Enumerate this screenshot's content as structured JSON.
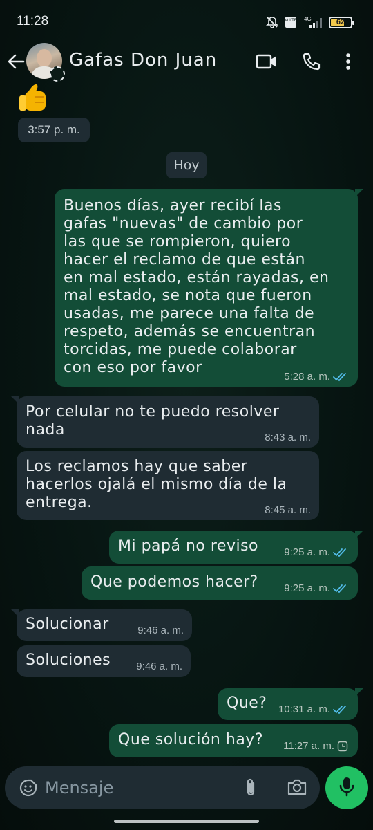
{
  "status_bar": {
    "time": "11:28",
    "battery": "62",
    "network": "4G",
    "volte": "VoLTE",
    "icons": [
      "mute-bell-icon",
      "volte-icon",
      "signal-icon",
      "battery-icon"
    ]
  },
  "header": {
    "contact_name": "Gafas Don Juan",
    "icons": [
      "back-arrow-icon",
      "avatar",
      "status-ring-icon",
      "video-call-icon",
      "phone-icon",
      "more-vert-icon"
    ]
  },
  "chat": {
    "prev_time": "3:57 p. m.",
    "date_chip": "Hoy",
    "messages": [
      {
        "direction": "out",
        "text": "Buenos días, ayer recibí las\ngafas \"nuevas\" de cambio por\nlas que se rompieron, quiero\nhacer el reclamo de que están\nen mal estado, están rayadas, en\nmal estado, se nota que fueron\nusadas, me parece una falta de\nrespeto, además se encuentran\ntorcidas, me puede colaborar\ncon eso por favor",
        "time": "5:28 a. m.",
        "status": "read"
      },
      {
        "direction": "in",
        "text": "Por celular no te puedo resolver\nnada",
        "time": "8:43 a. m."
      },
      {
        "direction": "in",
        "text": "Los reclamos hay que saber\nhacerlos ojalá el mismo día de la\nentrega.",
        "time": "8:45 a. m."
      },
      {
        "direction": "out",
        "text": "Mi papá no reviso",
        "time": "9:25 a. m.",
        "status": "read"
      },
      {
        "direction": "out",
        "text": "Que podemos hacer?",
        "time": "9:25 a. m.",
        "status": "read"
      },
      {
        "direction": "in",
        "text": "Solucionar",
        "time": "9:46 a. m."
      },
      {
        "direction": "in",
        "text": "Soluciones",
        "time": "9:46 a. m."
      },
      {
        "direction": "out",
        "text": "Que?",
        "time": "10:31 a. m.",
        "status": "read"
      },
      {
        "direction": "out",
        "text": "Que solución hay?",
        "time": "11:27 a. m.",
        "status": "pending"
      }
    ]
  },
  "input_bar": {
    "placeholder": "Mensaje",
    "icons": [
      "sticker-icon",
      "paperclip-icon",
      "camera-icon",
      "mic-icon"
    ]
  },
  "colors": {
    "outgoing_bubble": "#134d37",
    "incoming_bubble": "#1f2c33",
    "read_ticks": "#53bdeb",
    "mic_button": "#21c063",
    "battery": "#f2c94c"
  }
}
